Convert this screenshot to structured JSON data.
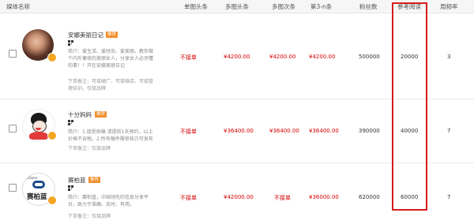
{
  "header": {
    "media_name": "媒体名称",
    "single_headline": "单图头条",
    "multi_headline": "多图头条",
    "multi_secondary": "多图次条",
    "third_to_n": "第3-n条",
    "fans": "粉丝数",
    "ref_reads": "参考阅读",
    "weekly_freq": "周频率"
  },
  "rows": [
    {
      "name": "安娜美丽日记",
      "tag": "推荐",
      "desc": "简介：爱生活、爱时尚、爱美丽。教你做个内外兼修的美丽女人，分享女人必须懂的事！！开在安娜美丽日记",
      "note": "下单备注：可接硬广、可接微店、可接管理培训，仅接品牌",
      "single_headline": "不接单",
      "multi_headline": "¥4200.00",
      "multi_secondary": "¥4200.00",
      "third_to_n": "¥4200.00",
      "fans": "500000",
      "ref_reads": "20000",
      "weekly_freq": "3"
    },
    {
      "name": "十分妈妈",
      "tag": "推荐",
      "desc": "简介：1.接受供稿 请提前1天预约，以上价格不含税。2.所有稿件需审核方可发布",
      "note": "下单备注：仅接品牌",
      "single_headline": "不接单",
      "multi_headline": "¥36400.00",
      "multi_secondary": "¥36400.00",
      "third_to_n": "¥36400.00",
      "fans": "390000",
      "ref_reads": "40000",
      "weekly_freq": "7"
    },
    {
      "name": "赛柏蓝",
      "tag": "推荐",
      "logo_text": "赛柏蓝",
      "logo_sub": "CoSeen",
      "desc": "简介：赛柏蓝，中国领先的信息分享平台，致力于准确、及时、有用。",
      "note": "下单备注：仅接品牌",
      "single_headline": "不接单",
      "multi_headline": "¥42000.00",
      "multi_secondary": "不接单",
      "third_to_n": "¥36000.00",
      "fans": "620000",
      "ref_reads": "60000",
      "weekly_freq": "7"
    }
  ],
  "colors": {
    "price": "#d40000",
    "highlight": "#d81c1c",
    "tag": "#f28e2b"
  }
}
